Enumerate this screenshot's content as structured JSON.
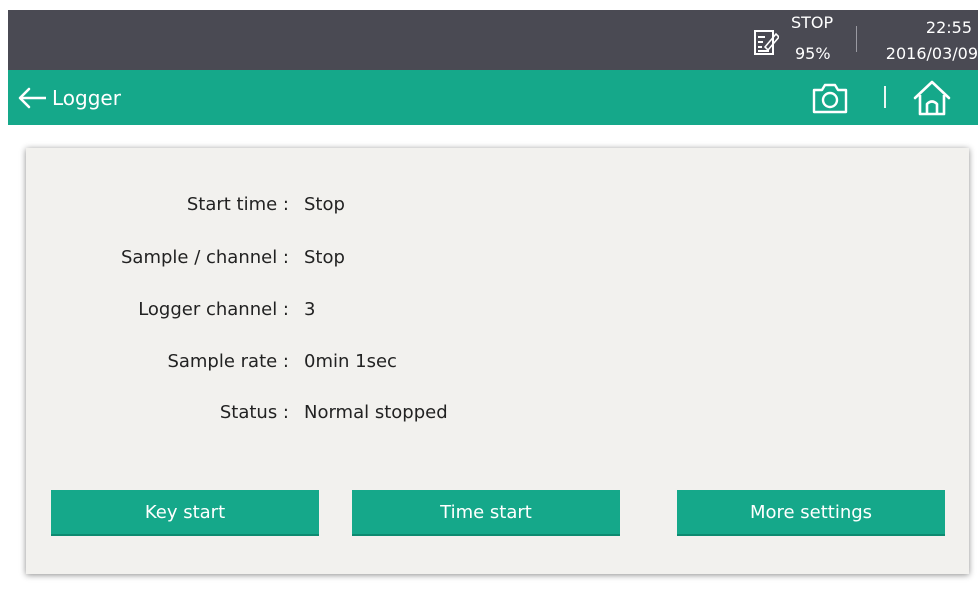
{
  "status_bar": {
    "logger_state": "STOP",
    "battery": "95%",
    "time": "22:55",
    "date": "2016/03/09",
    "logger_icon": "logger-edit-icon"
  },
  "header": {
    "title": "Logger",
    "back_icon": "arrow-left-icon",
    "camera_icon": "camera-icon",
    "home_icon": "home-icon"
  },
  "info": [
    {
      "label": "Start time :",
      "value": "Stop"
    },
    {
      "label": "Sample / channel :",
      "value": "Stop"
    },
    {
      "label": "Logger channel :",
      "value": "3"
    },
    {
      "label": "Sample rate :",
      "value": "0min 1sec"
    },
    {
      "label": "Status :",
      "value": "Normal stopped"
    }
  ],
  "buttons": {
    "key_start": "Key start",
    "time_start": "Time start",
    "more_settings": "More settings"
  },
  "colors": {
    "status_bar": "#4a4a53",
    "accent": "#15a88a",
    "card": "#f2f1ee"
  }
}
